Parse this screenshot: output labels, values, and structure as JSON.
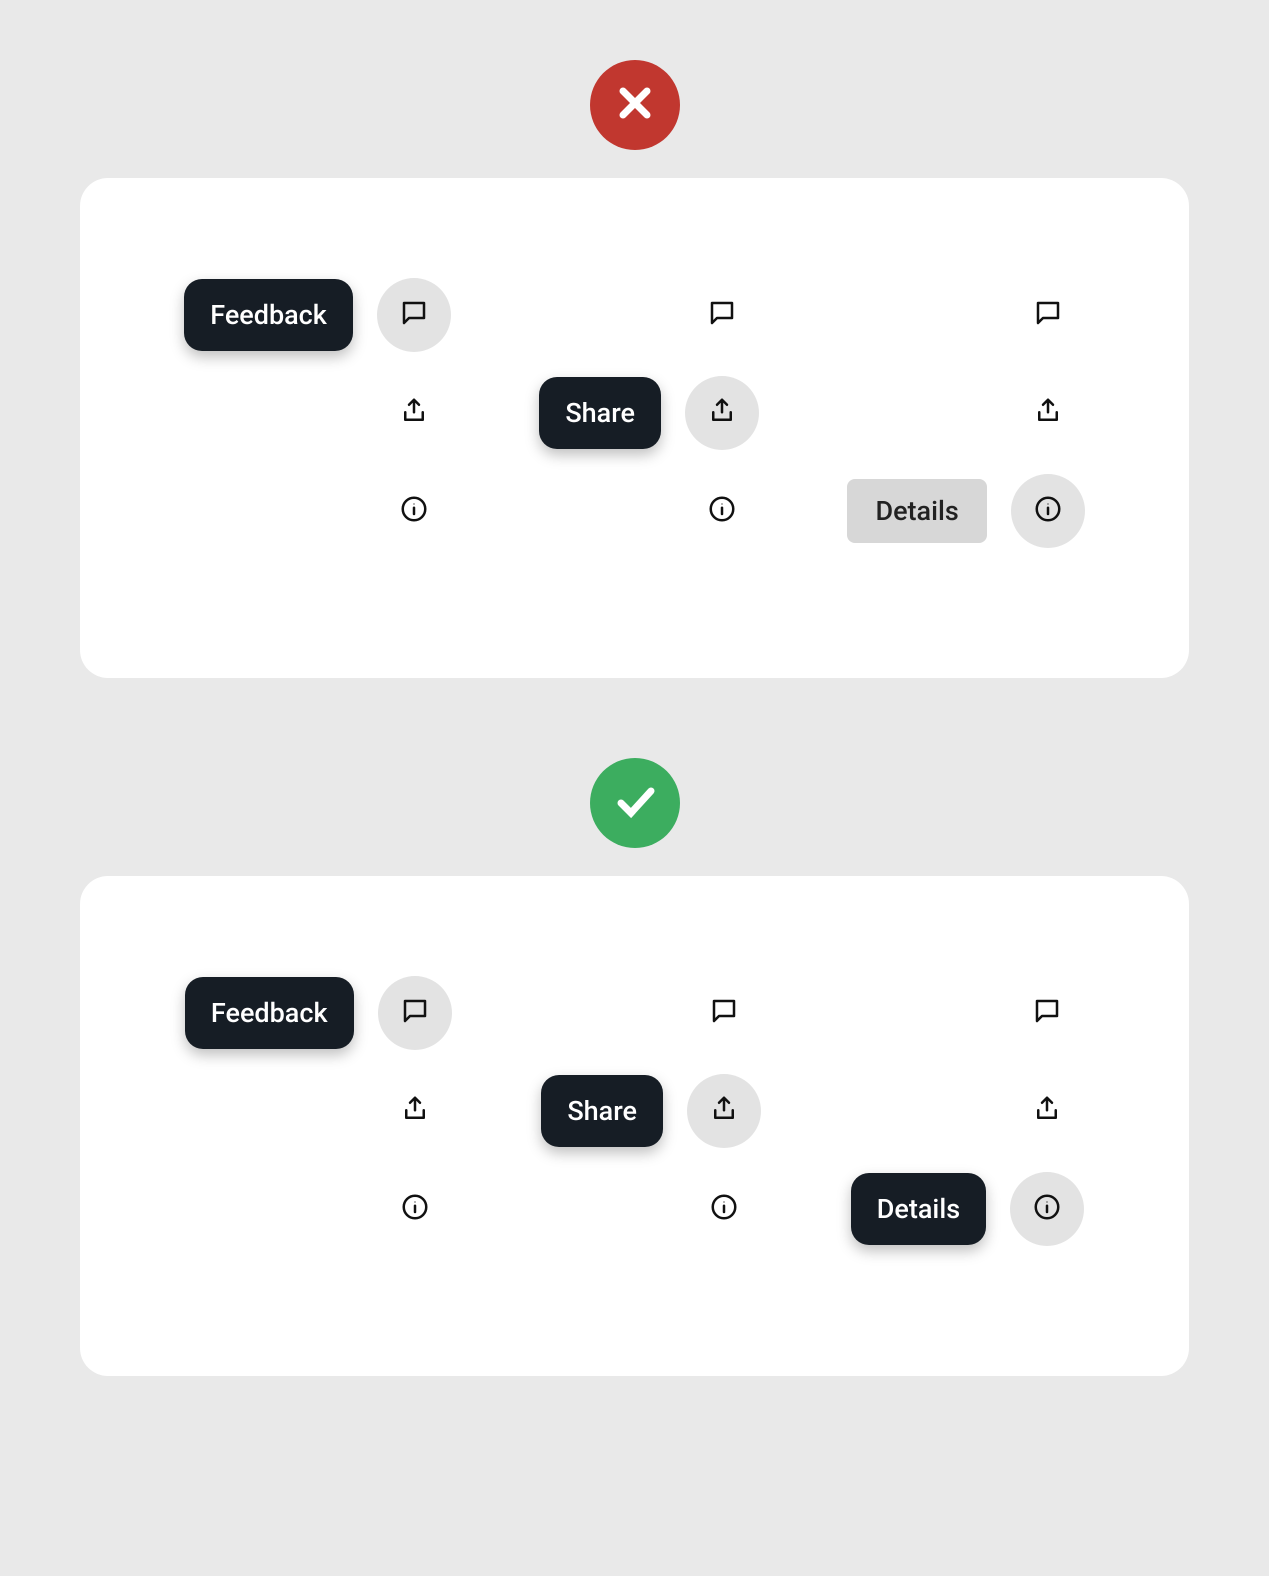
{
  "tooltips": {
    "feedback": "Feedback",
    "share": "Share",
    "details": "Details"
  },
  "colors": {
    "bad": "#c1372f",
    "good": "#3cad5f",
    "tooltip_dark_bg": "#161d25",
    "tooltip_light_bg": "#d7d7d7"
  }
}
